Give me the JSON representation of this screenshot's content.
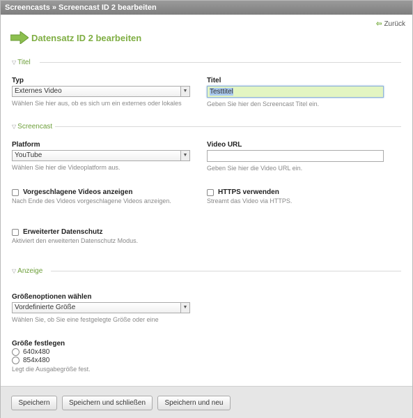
{
  "breadcrumb": "Screencasts » Screencast ID 2 bearbeiten",
  "back_label": "Zurück",
  "page_title": "Datensatz ID 2 bearbeiten",
  "sections": {
    "titel": "Titel",
    "screencast": "Screencast",
    "anzeige": "Anzeige"
  },
  "typ": {
    "label": "Typ",
    "value": "Externes Video",
    "hint": "Wählen Sie hier aus, ob es sich um ein externes oder lokales"
  },
  "titel": {
    "label": "Titel",
    "value": "Testtitel",
    "hint": "Geben Sie hier den Screencast Titel ein."
  },
  "platform": {
    "label": "Platform",
    "value": "YouTube",
    "hint": "Wählen Sie hier die Videoplatform aus."
  },
  "video_url": {
    "label": "Video URL",
    "value": "",
    "hint": "Geben Sie hier die Video URL ein."
  },
  "suggested": {
    "label": "Vorgeschlagene Videos anzeigen",
    "hint": "Nach Ende des Videos vorgeschlagene Videos anzeigen.",
    "checked": false
  },
  "https": {
    "label": "HTTPS verwenden",
    "hint": "Streamt das Video via HTTPS.",
    "checked": false
  },
  "privacy": {
    "label": "Erweiterter Datenschutz",
    "hint": "Aktiviert den erweiterten Datenschutz Modus.",
    "checked": false
  },
  "size_options": {
    "label": "Größenoptionen wählen",
    "value": "Vordefinierte Größe",
    "hint": "Wählen Sie, ob Sie eine festgelegte Größe oder eine"
  },
  "fixed_size": {
    "label": "Größe festlegen",
    "options": [
      "640x480",
      "854x480"
    ],
    "hint": "Legt die Ausgabegröße fest."
  },
  "buttons": {
    "save": "Speichern",
    "save_close": "Speichern und schließen",
    "save_new": "Speichern und neu"
  },
  "colors": {
    "accent": "#7fae43",
    "focus_bg": "#e3f5c2"
  }
}
